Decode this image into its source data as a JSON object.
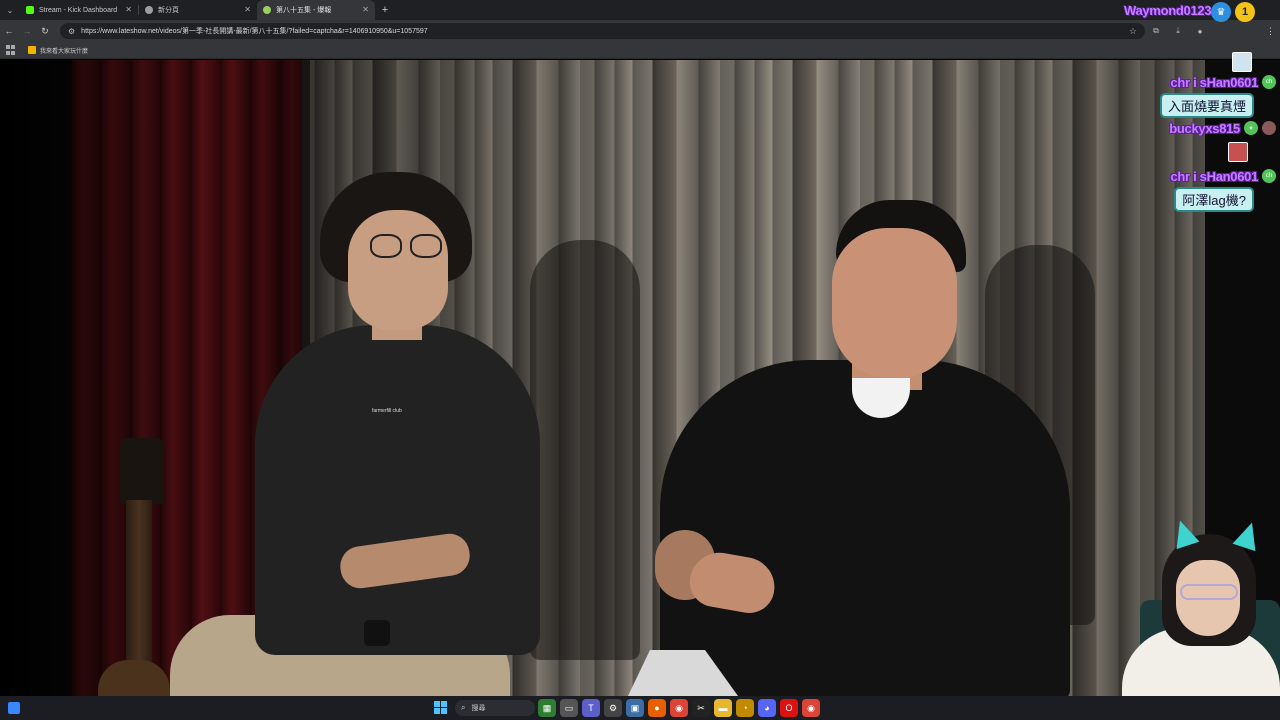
{
  "browser": {
    "tabs": [
      {
        "label": "Stream - Kick Dashboard",
        "icon": "kick-icon",
        "color": "#53fc18",
        "active": false
      },
      {
        "label": "新分頁",
        "icon": "globe-icon",
        "color": "#9aa0a6",
        "active": false
      },
      {
        "label": "第八十五集 - 爆報",
        "icon": "site-icon",
        "color": "#9ad15a",
        "active": true
      }
    ],
    "new_tab_symbol": "+",
    "url": "https://www.lateshow.net/videos/第一季-社長開講-最新/第八十五集/?failed=captcha&r=1406910950&u=1057597",
    "bookmark_label": "我來看大家玩什麼"
  },
  "overlay": {
    "top_username": "Waymond01234",
    "rank_badge": "1",
    "chat": [
      {
        "type": "user",
        "name": "chr i sHan0601",
        "badge": "ch"
      },
      {
        "type": "message",
        "text": "入面燒要真煙"
      },
      {
        "type": "user",
        "name": "buckyxs815",
        "badge": "✦"
      },
      {
        "type": "emote",
        "emote": "gift-emote"
      },
      {
        "type": "user",
        "name": "chr i sHan0601",
        "badge": "ch"
      },
      {
        "type": "message",
        "text": "阿澤lag機?"
      }
    ]
  },
  "video": {
    "shirt_text": "farmerfill club"
  },
  "taskbar": {
    "search_placeholder": "搜尋",
    "apps": [
      "widgets-icon",
      "file-explorer-icon",
      "teams-icon",
      "settings-icon",
      "photos-icon",
      "firefox-icon",
      "chrome-icon",
      "capcut-icon",
      "folder-icon",
      "clock-icon",
      "discord-icon",
      "opera-icon",
      "chrome-icon"
    ]
  },
  "colors": {
    "username": "#c77dff",
    "chat_bubble": "#c8f0f0",
    "badge_green": "#53c35a"
  }
}
